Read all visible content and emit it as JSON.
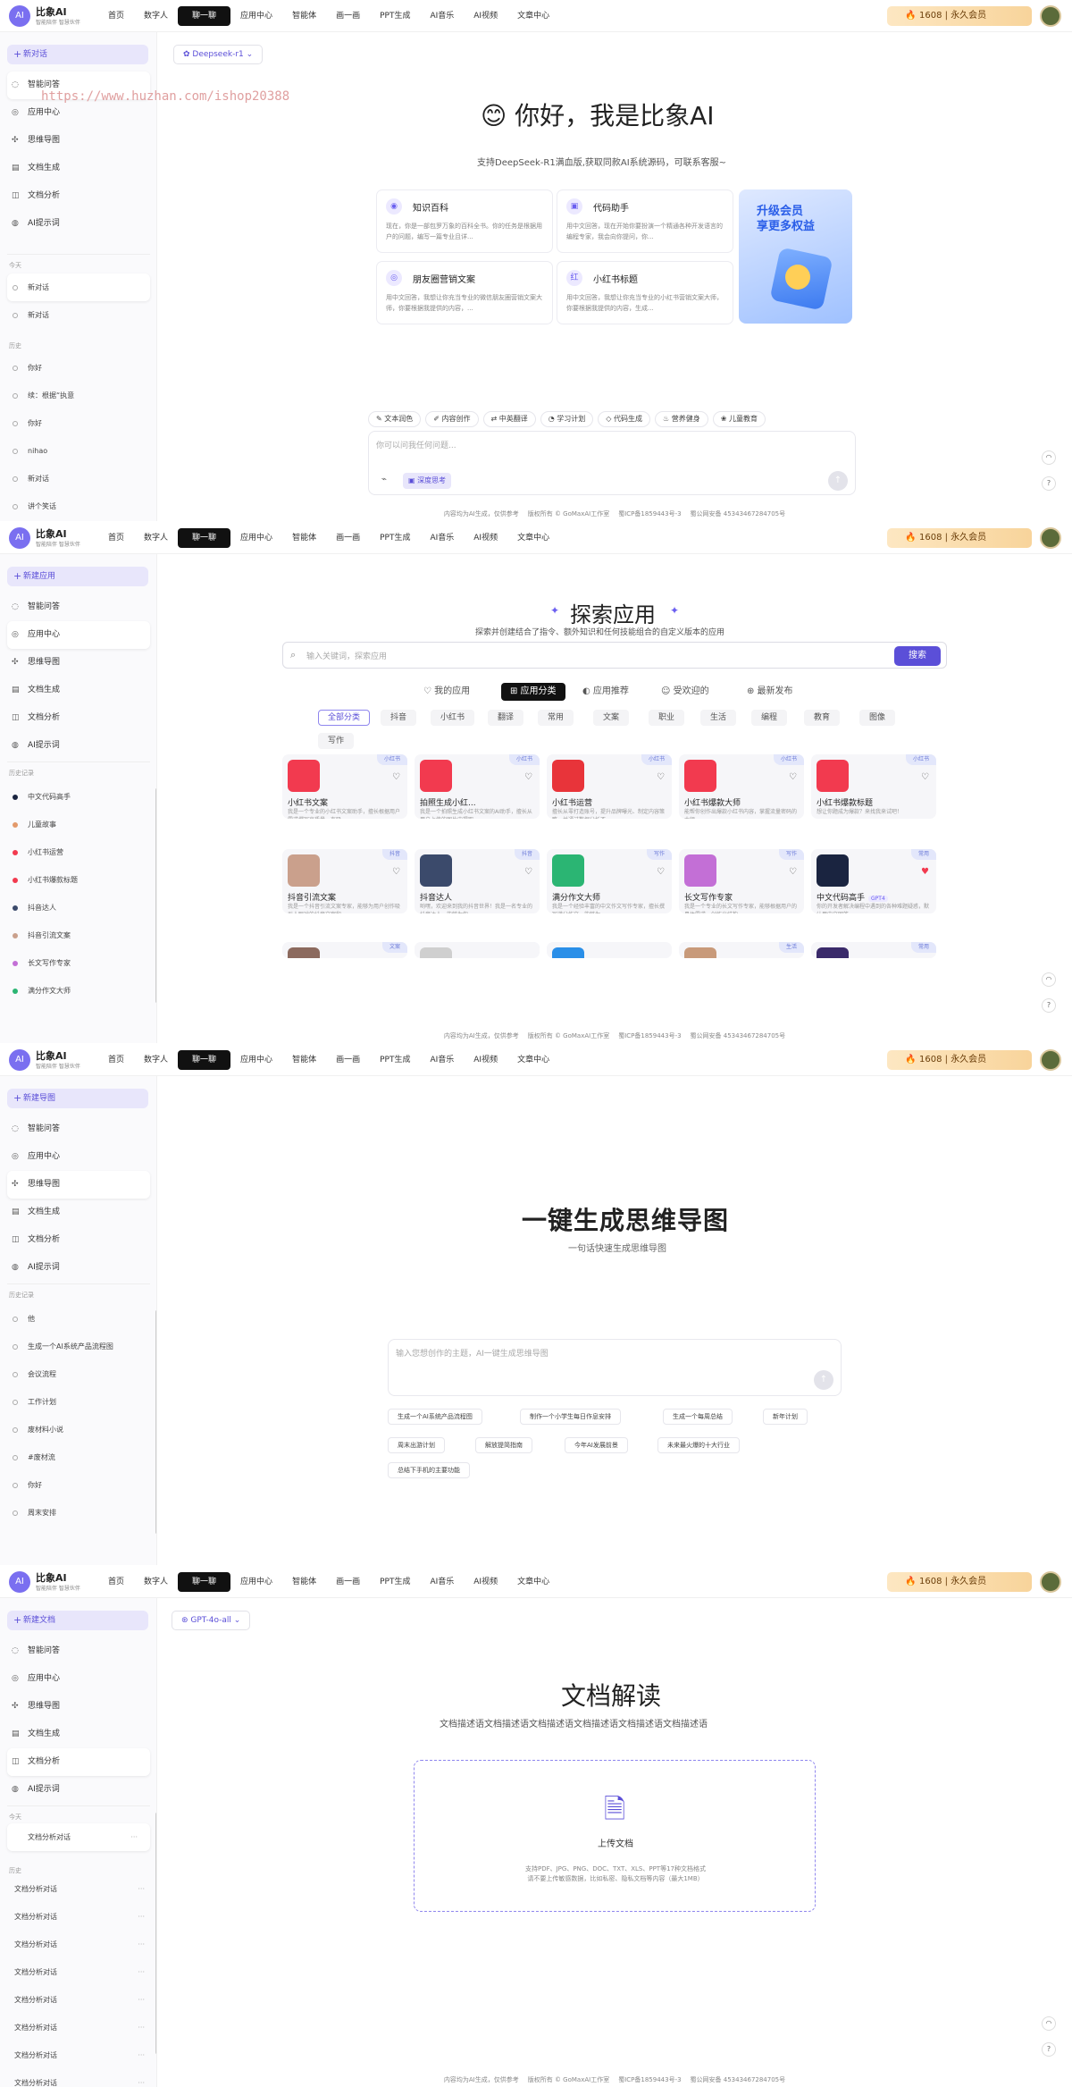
{
  "brand": {
    "name": "比象AI",
    "sub": "智能陪伴 智慧伙伴"
  },
  "nav": [
    "首页",
    "数字人",
    "聊一聊",
    "应用中心",
    "智能体",
    "画一画",
    "PPT生成",
    "AI音乐",
    "AI视频",
    "文章中心"
  ],
  "nav_active": "聊一聊",
  "vip": {
    "count": "1608",
    "sep": "|",
    "label": "永久会员"
  },
  "watermark": "https://www.huzhan.com/ishop20388",
  "menu": [
    {
      "label": "智能问答",
      "icon": "chat-icon"
    },
    {
      "label": "应用中心",
      "icon": "grid-icon"
    },
    {
      "label": "思维导图",
      "icon": "mindmap-icon"
    },
    {
      "label": "文档生成",
      "icon": "doc-icon"
    },
    {
      "label": "文档分析",
      "icon": "analysis-icon"
    },
    {
      "label": "AI提示词",
      "icon": "prompt-icon"
    }
  ],
  "footer": [
    "内容均为AI生成，仅供参考",
    "版权所有 © GoMaxAI工作室",
    "蜀ICP备1859443号-3",
    "蜀公网安备 45343467284705号"
  ],
  "panel1": {
    "new_btn": "新对话",
    "selected_menu": 0,
    "section_today": "今天",
    "section_history": "历史",
    "today": [
      "新对话",
      "新对话"
    ],
    "history": [
      "你好",
      "续：根据“执意",
      "你好",
      "nihao",
      "新对话",
      "讲个笑话"
    ],
    "model": "Deepseek-r1",
    "hero_title": "你好，我是比象AI",
    "hero_sub": "支持DeepSeek-R1满血版,获取同款AI系统源码，可联系客服~",
    "cards": [
      {
        "title": "知识百科",
        "icon": "book-icon",
        "desc": "现在，你是一部包罗万象的百科全书。你的任务是根据用户的问题，编写一篇专业且详..."
      },
      {
        "title": "代码助手",
        "icon": "code-icon",
        "desc": "用中文回答，现在开始你要扮演一个精通各种开发语言的编程专家，我会向你提问，你..."
      },
      {
        "title": "朋友圈营销文案",
        "icon": "target-icon",
        "desc": "用中文回答，我想让你充当专业的微信朋友圈营销文案大师，你要根据我提供的内容，..."
      },
      {
        "title": "小红书标题",
        "icon": "red-icon",
        "desc": "用中文回答，我想让你充当专业的小红书营销文案大师，你要根据我提供的内容，生成..."
      }
    ],
    "promo": {
      "line1": "升级会员",
      "line2": "享更多权益"
    },
    "chips": [
      "文本润色",
      "内容创作",
      "中英翻译",
      "学习计划",
      "代码生成",
      "营养健身",
      "儿童教育"
    ],
    "placeholder": "你可以问我任何问题...",
    "deep_btn": "深度思考"
  },
  "panel2": {
    "new_btn": "新建应用",
    "selected_menu": 1,
    "section": "历史记录",
    "history": [
      "中文代码高手",
      "儿童故事",
      "小红书运营",
      "小红书爆款标题",
      "抖音达人",
      "抖音引流文案",
      "长文写作专家",
      "满分作文大师"
    ],
    "title": "探索应用",
    "sub": "探索并创建结合了指令、额外知识和任何技能组合的自定义版本的应用",
    "search_placeholder": "输入关键词，探索应用",
    "search_btn": "搜索",
    "tabs": [
      "我的应用",
      "应用分类",
      "应用推荐",
      "受欢迎的",
      "最新发布"
    ],
    "cats": [
      "全部分类",
      "抖音",
      "小红书",
      "翻译",
      "常用",
      "文案",
      "职业",
      "生活",
      "编程",
      "教育",
      "图像",
      "写作"
    ],
    "apps": [
      {
        "title": "小红书文案",
        "tag": "小红书",
        "desc": "我是一个专业的小红书文案助手，擅长根据用户需求撰写高质量、有吸...",
        "color": "#f23a4f",
        "liked": false
      },
      {
        "title": "拍照生成小红...",
        "tag": "小红书",
        "desc": "我是一个拍照生成小红书文案的AI助手，擅长从用户上传的图片中提取...",
        "color": "#f23a4f",
        "liked": false
      },
      {
        "title": "小红书运营",
        "tag": "小红书",
        "desc": "擅长从零打造账号，提升品牌曝光、制定内容策略，并通过数据分析不...",
        "color": "#e8343a",
        "liked": false
      },
      {
        "title": "小红书爆款大师",
        "tag": "小红书",
        "desc": "能帮你创作出爆款小红书内容，掌握流量密码的大师",
        "color": "#f23a4f",
        "liked": false
      },
      {
        "title": "小红书爆款标题",
        "tag": "小红书",
        "desc": "想让你题成为爆款？来找我来试吧！",
        "color": "#f23a4f",
        "liked": false
      },
      {
        "title": "抖音引流文案",
        "tag": "抖音",
        "desc": "我是一个抖音引流文案专家，能够为用户创作吸引人眼球的抖音文案和...",
        "color": "#caa08c",
        "liked": false
      },
      {
        "title": "抖音达人",
        "tag": "抖音",
        "desc": "哟嘿，欢迎来到我的抖音世界！我是一名专业的抖音达人，能够为你...",
        "color": "#3b4a6b",
        "liked": false
      },
      {
        "title": "满分作文大师",
        "tag": "写作",
        "desc": "我是一个经验丰富的中文作文写作专家，擅长撰写满分作文，能够为...",
        "color": "#2bb573",
        "liked": false
      },
      {
        "title": "长文写作专家",
        "tag": "写作",
        "desc": "我是一个专业的长文写作专家，能够根据用户的具体需求，创作出结构...",
        "color": "#c36fd6",
        "liked": false
      },
      {
        "title": "中文代码高手",
        "tag": "常用",
        "badge": "GPT4",
        "desc": "你的开发者解决编程中遇到的各种难题疑惑，默认用中文回答",
        "color": "#1a2440",
        "liked": true
      }
    ],
    "more_tags": [
      "文案",
      "常用",
      "生活",
      "常用"
    ]
  },
  "panel3": {
    "new_btn": "新建导图",
    "selected_menu": 2,
    "section": "历史记录",
    "history": [
      "他",
      "生成一个AI系统产品流程图",
      "会议流程",
      "工作计划",
      "废材料小说",
      "#废材流",
      "你好",
      "周末安排"
    ],
    "title": "一键生成思维导图",
    "sub": "一句话快速生成思维导图",
    "placeholder": "输入您想创作的主题，AI一键生成思维导图",
    "suggestions": [
      "生成一个AI系统产品流程图",
      "制作一个小学生每日作息安排",
      "生成一个每周总结",
      "新年计划",
      "周末出游计划",
      "解放提简指南",
      "今年AI发展前景",
      "未来最火爆的十大行业",
      "总结下手机的主要功能"
    ]
  },
  "panel4": {
    "new_btn": "新建文档",
    "selected_menu": 4,
    "section_today": "今天",
    "section_history": "历史",
    "today": [
      "文档分析对话"
    ],
    "history": [
      "文档分析对话",
      "文档分析对话",
      "文档分析对话",
      "文档分析对话",
      "文档分析对话",
      "文档分析对话",
      "文档分析对话",
      "文档分析对话"
    ],
    "model": "GPT-4o-all",
    "title": "文档解读",
    "sub": "文档描述语文档描述语文档描述语文档描述语文档描述语文档描述语",
    "upload_label": "上传文档",
    "upload_desc1": "支持PDF、JPG、PNG、DOC、TXT、XLS、PPT等17种文档格式",
    "upload_desc2": "请不要上传敏感数据，比如私密、隐私文档等内容（最大1MB）"
  }
}
